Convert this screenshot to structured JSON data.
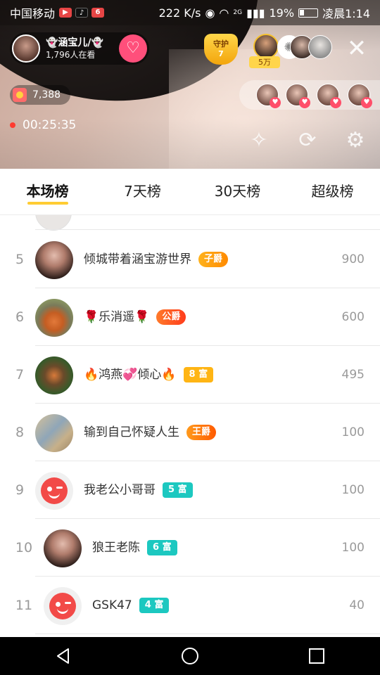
{
  "status_bar": {
    "carrier": "中国移动",
    "speed": "222 K/s",
    "battery": "19%",
    "time": "凌晨1:14",
    "network": "2G"
  },
  "live": {
    "host_name": "👻涵宝儿/👻",
    "watching": "1,796人在看",
    "guard_label": "守护",
    "guard_count": "7",
    "top_fan_tag": "5万",
    "coins": "7,388",
    "duration": "00:25:35"
  },
  "tabs": [
    {
      "label": "本场榜",
      "active": true
    },
    {
      "label": "7天榜",
      "active": false
    },
    {
      "label": "30天榜",
      "active": false
    },
    {
      "label": "超级榜",
      "active": false
    }
  ],
  "ranking": [
    {
      "rank": "5",
      "name": "倾城带着涵宝游世界",
      "badge": "子爵",
      "badge_style": "b-zijue",
      "score": "900",
      "avatar": "av-woman"
    },
    {
      "rank": "6",
      "name": "🌹乐消遥🌹",
      "badge": "公爵",
      "badge_style": "b-gongjue",
      "score": "600",
      "avatar": "av-robin"
    },
    {
      "rank": "7",
      "name": "🔥鸿燕💞倾心🔥",
      "badge": "8 富",
      "badge_style": "b-fu8",
      "score": "495",
      "avatar": "av-duck"
    },
    {
      "rank": "8",
      "name": "输到自己怀疑人生",
      "badge": "王爵",
      "badge_style": "b-wangjue",
      "score": "100",
      "avatar": "av-map"
    },
    {
      "rank": "9",
      "name": "我老公小哥哥",
      "badge": "5 富",
      "badge_style": "b-fu",
      "score": "100",
      "avatar": "av-default"
    },
    {
      "rank": "10",
      "name": "狼王老陈",
      "badge": "6 富",
      "badge_style": "b-fu",
      "score": "100",
      "avatar": "av-woman"
    },
    {
      "rank": "11",
      "name": "GSK47",
      "badge": "4 富",
      "badge_style": "b-fu",
      "score": "40",
      "avatar": "av-default"
    }
  ],
  "colors": {
    "tab_indicator": "#ffcc33",
    "follow_button": "#ff4f7b",
    "rich_badge": "#1cc8c0",
    "gold_badge": "#ffb514"
  },
  "icons": {
    "follow": "heart-plus-icon",
    "close": "close-icon",
    "beauty": "magic-wand-icon",
    "camera": "camera-switch-icon",
    "settings": "gear-icon",
    "back": "back-triangle-icon",
    "home": "home-circle-icon",
    "recents": "recents-square-icon"
  }
}
